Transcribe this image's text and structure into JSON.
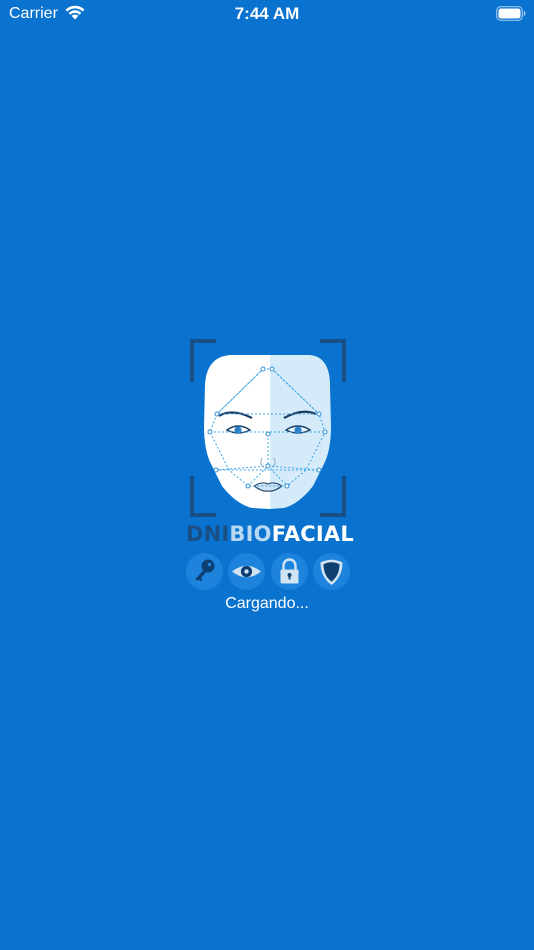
{
  "status_bar": {
    "carrier": "Carrier",
    "time": "7:44 AM",
    "wifi_icon": "wifi-icon",
    "battery_icon": "battery-icon"
  },
  "splash": {
    "background_color": "#0a72cf",
    "brand": {
      "part1": "DNI",
      "part2": "BIO",
      "part3": "FACIAL"
    },
    "feature_icons": [
      "key-icon",
      "eye-icon",
      "padlock-icon",
      "shield-icon"
    ],
    "loading_text": "Cargando..."
  }
}
